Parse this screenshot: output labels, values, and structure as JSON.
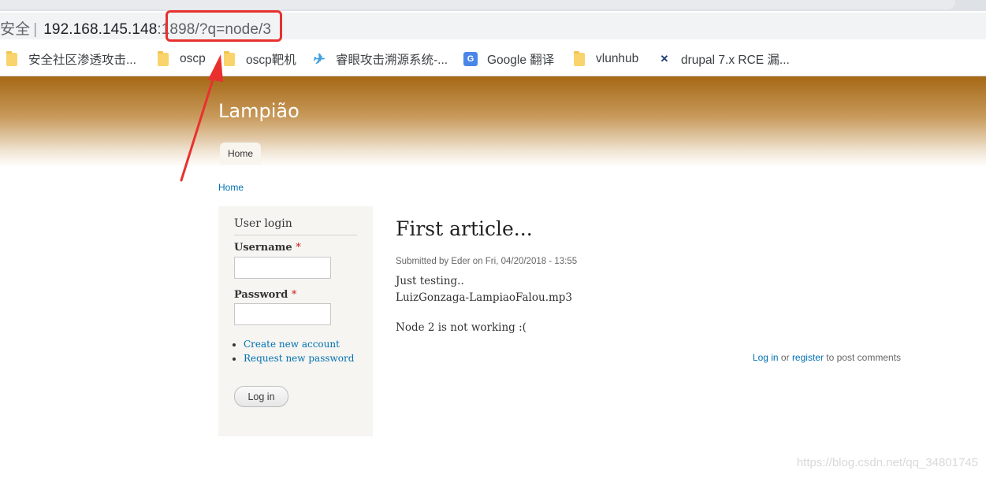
{
  "browser": {
    "address": {
      "security": "安全",
      "host": "192.168.145.148",
      "port": ":1898",
      "path": "/?q=node/3"
    },
    "bookmarks": [
      {
        "label": "安全社区渗透攻击...",
        "icon": "folder-icon"
      },
      {
        "label": "oscp",
        "icon": "folder-icon"
      },
      {
        "label": "oscp靶机",
        "icon": "folder-icon"
      },
      {
        "label": "睿眼攻击溯源系统-...",
        "icon": "bird-icon"
      },
      {
        "label": "Google 翻译",
        "icon": "google-translate-icon"
      },
      {
        "label": "vlunhub",
        "icon": "folder-icon"
      },
      {
        "label": "drupal 7.x RCE 漏...",
        "icon": "xk-icon"
      }
    ]
  },
  "site": {
    "name": "Lampião",
    "nav_home": "Home",
    "breadcrumb": "Home"
  },
  "login_block": {
    "title": "User login",
    "username_label": "Username",
    "password_label": "Password",
    "required_mark": "*",
    "links": [
      "Create new account",
      "Request new password"
    ],
    "submit": "Log in"
  },
  "article": {
    "title": "First article...",
    "submitted": "Submitted by Eder on Fri, 04/20/2018 - 13:55",
    "line1": "Just testing..",
    "line2": "LuizGonzaga-LampiaoFalou.mp3",
    "line3": "Node 2 is not working :(",
    "comments": {
      "login": "Log in",
      "or": " or ",
      "register": "register",
      "rest": " to post comments"
    }
  },
  "watermark": "https://blog.csdn.net/qq_34801745",
  "colors": {
    "accent": "#0071b3",
    "annotation": "#e8312e",
    "header_brown": "#a56815"
  }
}
